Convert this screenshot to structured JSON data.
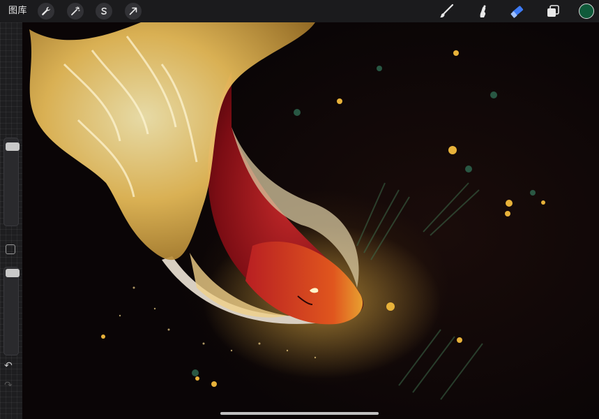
{
  "toolbar": {
    "gallery_label": "图库",
    "left_tools": [
      "wrench-icon",
      "magic-wand-icon",
      "selection-icon",
      "transform-arrow-icon"
    ],
    "right_tools": [
      "brush-icon",
      "smudge-icon",
      "eraser-icon",
      "layers-icon"
    ],
    "active_tool": "eraser-icon",
    "color": "#0f5a3a",
    "accent": "#3d7bf5"
  },
  "sidebar": {
    "brush_size_level": 0.2,
    "opacity_level": 0.05,
    "undo_icon": "undo-icon",
    "redo_icon": "redo-icon"
  },
  "canvas": {
    "artwork": "red-fish-with-golden-flame-fins",
    "background": "#0b0707"
  }
}
